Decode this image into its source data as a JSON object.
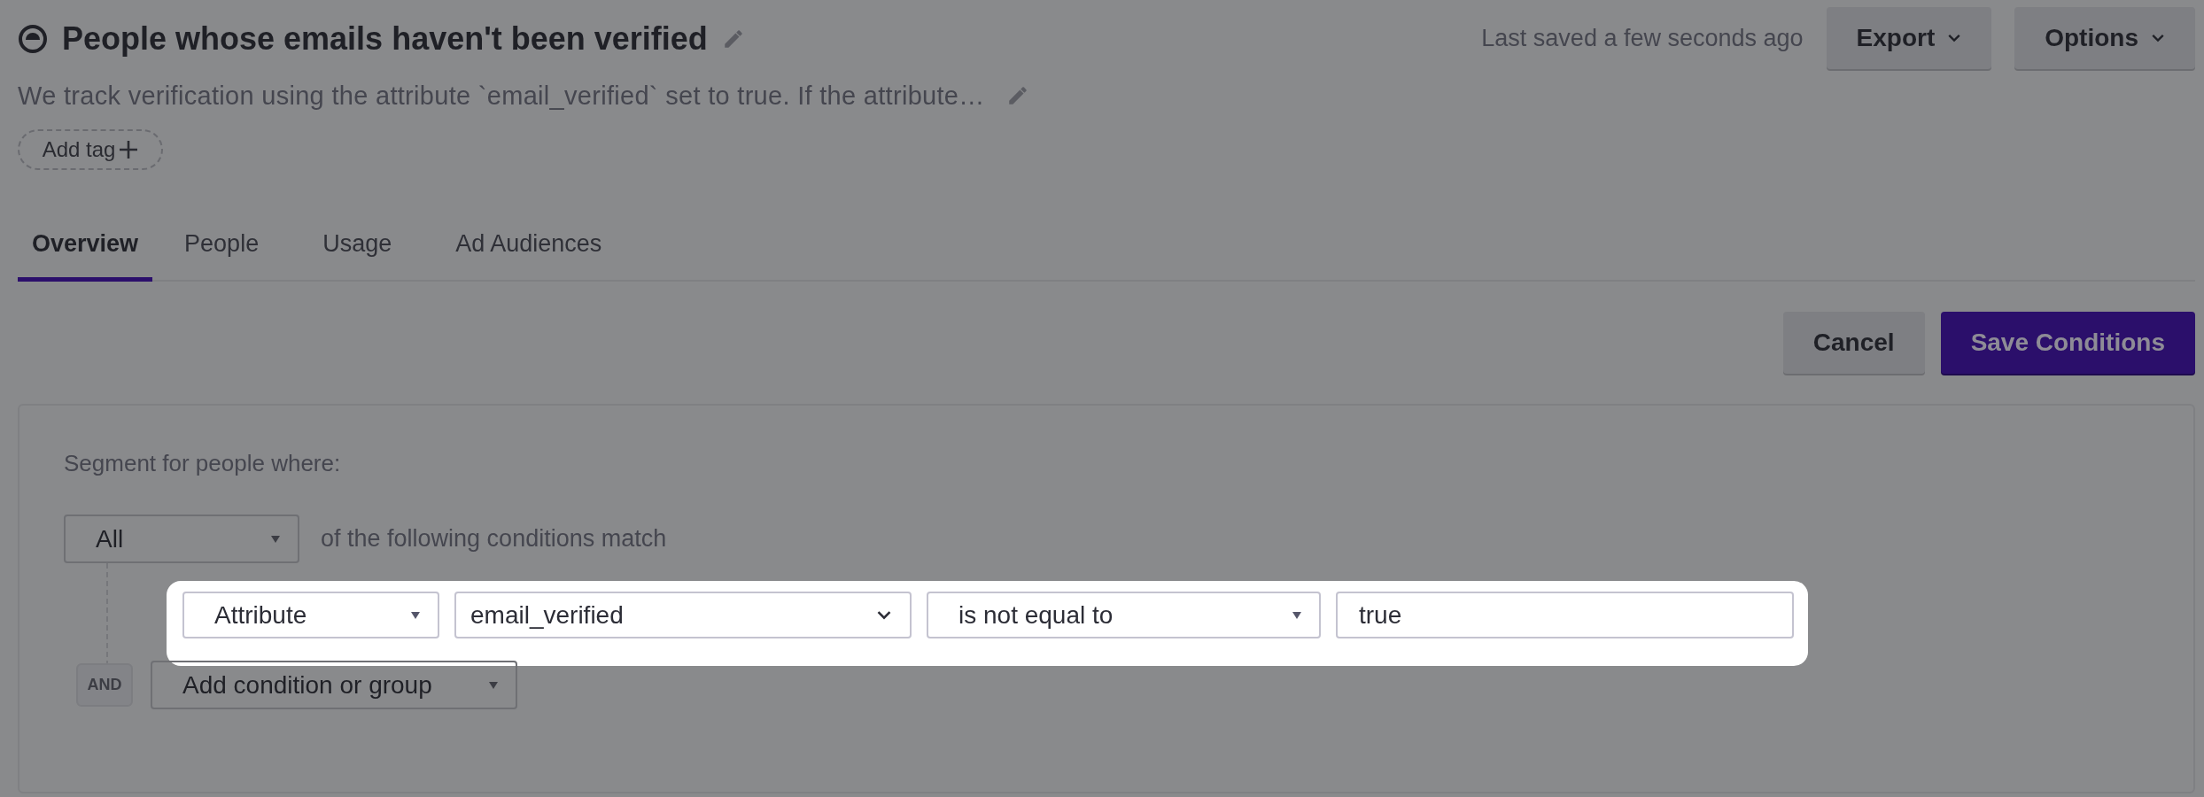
{
  "header": {
    "title": "People whose emails haven't been verified",
    "description": "We track verification using the attribute `email_verified` set to true. If the attribute…",
    "add_tag": "Add tag",
    "last_saved": "Last saved a few seconds ago",
    "actions": [
      {
        "label": "Export"
      },
      {
        "label": "Options"
      }
    ]
  },
  "tabs": [
    {
      "label": "Overview",
      "selected": true
    },
    {
      "label": "People",
      "selected": false
    },
    {
      "label": "Usage",
      "selected": false
    },
    {
      "label": "Ad Audiences",
      "selected": false
    }
  ],
  "buttons": {
    "cancel": "Cancel",
    "save": "Save Conditions"
  },
  "segment": {
    "intro": "Segment for people where:",
    "match": {
      "value": "All",
      "suffix": "of the following conditions match"
    },
    "condition": {
      "highlighted": true,
      "fields": [
        {
          "kind": "select",
          "value": "Attribute"
        },
        {
          "kind": "combobox",
          "value": "email_verified"
        },
        {
          "kind": "select",
          "value": "is not equal to"
        },
        {
          "kind": "input",
          "value": "true"
        }
      ]
    },
    "joiner": "AND",
    "add": "Add condition or group"
  }
}
